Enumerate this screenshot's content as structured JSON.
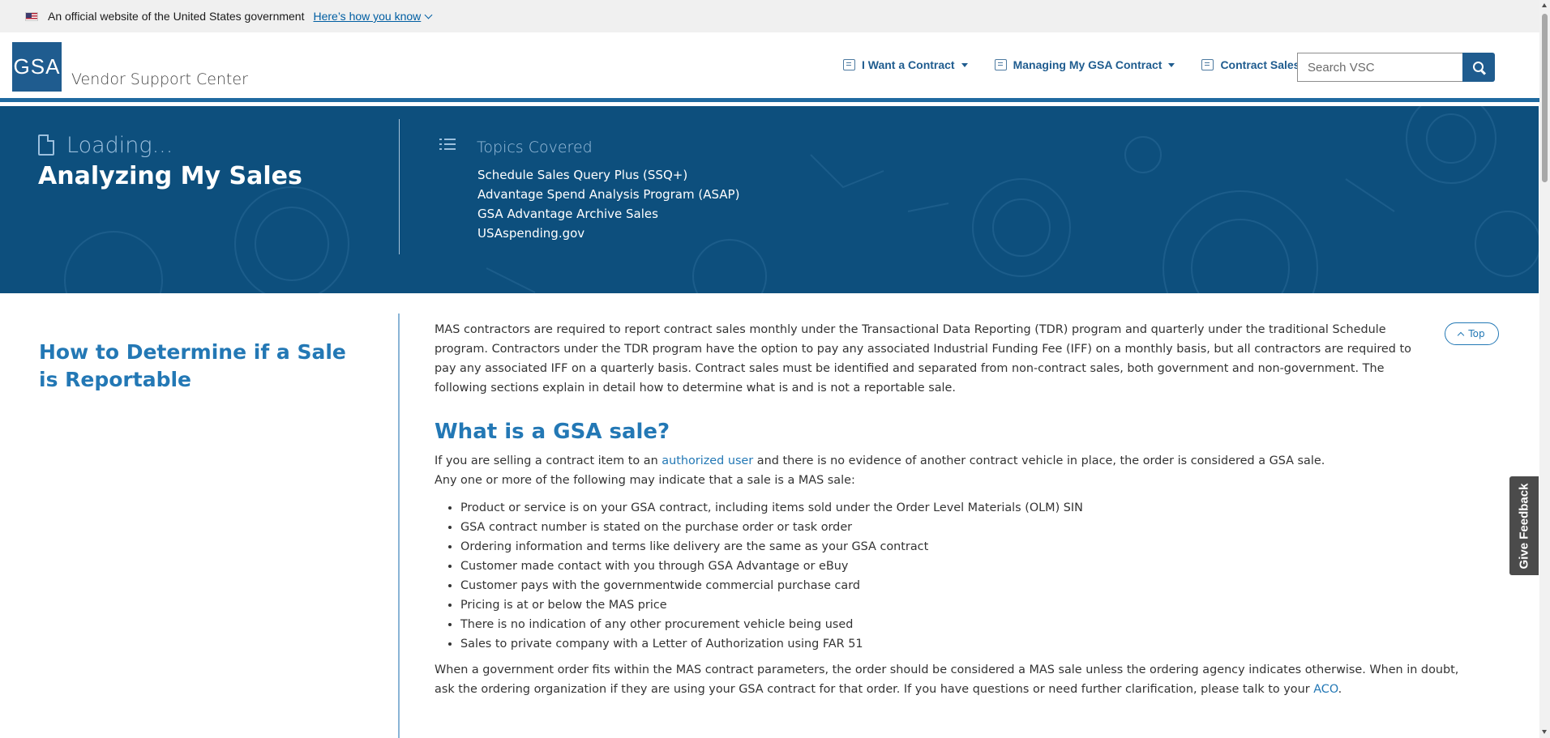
{
  "gov_banner": {
    "official_text": "An official website of the United States government",
    "how_you_know": "Here’s how you know"
  },
  "header": {
    "logo_text": "GSA",
    "site_name": "Vendor Support Center",
    "nav": [
      {
        "label": "I Want a Contract",
        "icon": "contract-icon"
      },
      {
        "label": "Managing My GSA Contract",
        "icon": "document-icon"
      },
      {
        "label": "Contract Sales",
        "icon": "calculator-icon"
      }
    ],
    "search_placeholder": "Search VSC"
  },
  "hero": {
    "loading_text": "Loading...",
    "title": "Analyzing My Sales",
    "topics_title": "Topics Covered",
    "topics": [
      "Schedule Sales Query Plus (SSQ+)",
      "Advantage Spend Analysis Program (ASAP)",
      "GSA Advantage Archive Sales",
      "USAspending.gov"
    ]
  },
  "sidebar": {
    "title": "How to Determine if a Sale is Reportable"
  },
  "content": {
    "intro": "MAS contractors are required to report contract sales monthly under the Transactional Data Reporting (TDR) program and quarterly under the traditional Schedule program. Contractors under the TDR program have the option to pay any associated Industrial Funding Fee (IFF) on a monthly basis, but all contractors are required to pay any associated IFF on a quarterly basis. Contract sales must be identified and separated from non-contract sales, both government and non-government. The following sections explain in detail how to determine what is and is not a reportable sale.",
    "heading": "What is a GSA sale?",
    "para1_before": "If you are selling a contract item to an ",
    "para1_link": "authorized user",
    "para1_after": " and there is no evidence of another contract vehicle in place, the order is considered a GSA sale.",
    "para2": "Any one or more of the following may indicate that a sale is a MAS sale:",
    "bullets": [
      "Product or service is on your GSA contract, including items sold under the Order Level Materials (OLM) SIN",
      "GSA contract number is stated on the purchase order or task order",
      "Ordering information and terms like delivery are the same as your GSA contract",
      "Customer made contact with you through GSA Advantage or eBuy",
      "Customer pays with the governmentwide commercial purchase card",
      "Pricing is at or below the MAS price",
      "There is no indication of any other procurement vehicle being used",
      "Sales to private company with a Letter of Authorization using FAR 51"
    ],
    "outro_before": "When a government order fits within the MAS contract parameters, the order should be considered a MAS sale unless the ordering agency indicates otherwise. When in doubt, ask the ordering organization if they are using your GSA contract for that order. If you have questions or need further clarification, please talk to your ",
    "outro_link": "ACO",
    "outro_after": "."
  },
  "top_button": "Top",
  "feedback_button": "Give Feedback",
  "colors": {
    "brand_blue": "#1f5c8f",
    "hero_bg": "#0d4f7d",
    "link_blue": "#2378b5"
  }
}
